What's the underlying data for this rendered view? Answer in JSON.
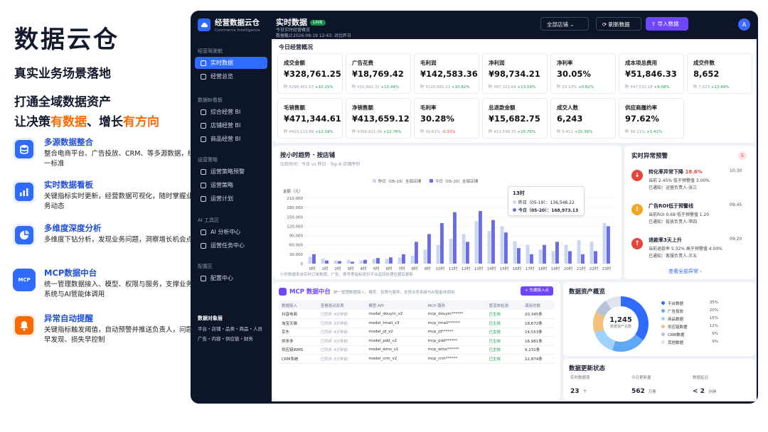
{
  "left": {
    "brand": "数据云仓",
    "tagline": "真实业务场景落地",
    "slogan1": "打通全域数据资产",
    "slogan2_a": "让决策",
    "slogan2_b": "有数据",
    "slogan2_c": "、增长",
    "slogan2_d": "有方向",
    "features": [
      {
        "icon": "database-icon",
        "color": "#2f6bff",
        "title": "多源数据整合",
        "desc": "整合电商平台、广告投放、CRM、等多源数据，统一标准"
      },
      {
        "icon": "bar-chart-icon",
        "color": "#2f6bff",
        "title": "实时数据看板",
        "desc": "关键指标实时更新，经营数据可视化，随时掌握业务动态"
      },
      {
        "icon": "pie-chart-icon",
        "color": "#2f6bff",
        "title": "多维度深度分析",
        "desc": "多维度下钻分析，发现业务问题，洞察增长机会点"
      },
      {
        "icon": "mcp-icon",
        "color": "#2f6bff",
        "title": "MCP数据中台",
        "desc": "统一管理数据接入、模型、权限与服务，支撑业务系统与AI管能体调用"
      },
      {
        "icon": "bell-icon",
        "color": "#ff6a00",
        "title": "异常自动提醒",
        "desc": "关键指标触发阈值，自动预警并推送负责人，问题早发现、损失早控制"
      }
    ]
  },
  "app": {
    "name": "经营数据云仓",
    "sub": "Commerce Intelligence",
    "sec1": "经营驾驶舱",
    "nav1": [
      "实时数据",
      "经营总览"
    ],
    "sec2": "数据BI看板",
    "nav2": [
      "综合经营 BI",
      "店铺经营 BI",
      "商品经营 BI"
    ],
    "sec3": "运营策略",
    "nav3": [
      "运营策略预警",
      "运营策略",
      "运营计划"
    ],
    "sec4": "AI 工具区",
    "nav4": [
      "AI 分析中心",
      "运营任务中心"
    ],
    "sec5": "配置区",
    "nav5": [
      "配置中心"
    ],
    "sec6": "数据对象层",
    "objs1": "平台・店铺・品类・商品・人员",
    "objs2": "广告・内容・供应链・财务",
    "title": "实时数据",
    "live": "LIVE",
    "sub1": "今日实时经营概览",
    "sub2": "数据截止2026-08-19 12:43: 对比昨日",
    "store_select": "全部店铺 ⌄",
    "refresh": "⟳ 刷新数据",
    "import": "⇧ 导入数据",
    "avatar": "A"
  },
  "overview": {
    "title": "今日经营概况",
    "kpis": [
      {
        "label": "成交金额",
        "value": "¥328,761.25",
        "prev": "¥298,451.67",
        "chg": "+10.15%",
        "dir": "up"
      },
      {
        "label": "广告花费",
        "value": "¥18,769.42",
        "prev": "¥16,842.31",
        "chg": "+11.44%",
        "dir": "up"
      },
      {
        "label": "毛利润",
        "value": "¥142,583.36",
        "prev": "¥128,665.22",
        "chg": "+10.82%",
        "dir": "up"
      },
      {
        "label": "净利润",
        "value": "¥98,734.21",
        "prev": "¥87,221.64",
        "chg": "+13.19%",
        "dir": "up"
      },
      {
        "label": "净利率",
        "value": "30.05%",
        "prev": "29.23%",
        "chg": "+0.82%",
        "dir": "up"
      },
      {
        "label": "成本项总费用",
        "value": "¥51,846.33",
        "prev": "¥47,532.18",
        "chg": "+9.08%",
        "dir": "up"
      },
      {
        "label": "成交件数",
        "value": "8,652",
        "prev": "7,623",
        "chg": "+13.49%",
        "dir": "up"
      },
      {
        "label": "毛销售额",
        "value": "¥471,344.61",
        "prev": "¥420,123.88",
        "chg": "+12.19%",
        "dir": "up"
      },
      {
        "label": "净销售额",
        "value": "¥413,659.12",
        "prev": "¥366,821.36",
        "chg": "+12.76%",
        "dir": "up"
      },
      {
        "label": "毛利率",
        "value": "30.28%",
        "prev": "30.61%",
        "chg": "-0.33%",
        "dir": "down"
      },
      {
        "label": "总退款金额",
        "value": "¥15,682.75",
        "prev": "¥13,548.33",
        "chg": "+15.76%",
        "dir": "up"
      },
      {
        "label": "成交人数",
        "value": "6,243",
        "prev": "5,412",
        "chg": "+15.36%",
        "dir": "up"
      },
      {
        "label": "供应商履约率",
        "value": "97.62%",
        "prev": "96.21%",
        "chg": "+1.41%",
        "dir": "up"
      }
    ]
  },
  "trend": {
    "title": "按小时趋势 · 按店铺",
    "subtitle": "比较时间：今日 vs 昨日 · Top 8 店铺序列",
    "note": "小时数据来自实时订单数据，广告、费号等指标按日平台返回处理估算后更新",
    "tooltip_title": "13时",
    "tooltip_y": "昨日（05-19）：136,548.22",
    "tooltip_t": "今日（05-20）：168,973.13"
  },
  "chart_data": {
    "type": "bar",
    "ylabel": "金额（元）",
    "ylim": [
      0,
      210000
    ],
    "yticks": [
      "210,000",
      "180,000",
      "150,000",
      "120,000",
      "90,000",
      "60,000",
      "30,000",
      "0"
    ],
    "categories": [
      "0时",
      "1时",
      "2时",
      "3时",
      "4时",
      "5时",
      "6时",
      "7时",
      "8时",
      "9时",
      "10时",
      "11时",
      "12时",
      "13时",
      "14时",
      "15时",
      "16时",
      "17时",
      "18时",
      "19时",
      "20时",
      "21时",
      "22时",
      "23时"
    ],
    "series": [
      {
        "name": "昨日（05-19）全部店铺",
        "color": "#c9d6f2",
        "values": [
          22000,
          16000,
          10000,
          12000,
          10000,
          15000,
          15000,
          20000,
          25000,
          45000,
          60000,
          80000,
          95000,
          136548,
          105000,
          120000,
          72000,
          60000,
          45000,
          40000,
          60000,
          75000,
          70000,
          130000
        ]
      },
      {
        "name": "今日（05-20）全部店铺",
        "color": "#6a6ce6",
        "values": [
          30000,
          10000,
          8000,
          6000,
          12000,
          18000,
          20000,
          30000,
          70000,
          95000,
          130000,
          165000,
          70000,
          168973,
          140000,
          100000,
          50000,
          30000,
          60000,
          70000,
          40000,
          30000,
          40000,
          120000
        ]
      }
    ]
  },
  "alerts": {
    "title": "实时异常预警",
    "count": "5",
    "items": [
      {
        "icon": "arrow-down-icon",
        "color": "#e5453b",
        "title": "转化率异常下降",
        "val": "18.6%",
        "time": "10:30",
        "line1": "当前 2.45% 低于预警值 3.00%",
        "line2": "已通知：运营负责人-张三"
      },
      {
        "icon": "warning-icon",
        "color": "#f5a524",
        "title": "广告ROI低于预警线",
        "val": "",
        "time": "09:45",
        "line1": "当前ROI 0.68 低于预警值 1.20",
        "line2": "已通知：投放负责人-李四"
      },
      {
        "icon": "arrow-up-icon",
        "color": "#e5453b",
        "title": "退款率3天上升",
        "val": "",
        "time": "09:20",
        "line1": "当前退款率 5.32% 高于预警值 4.00%",
        "line2": "已通知：客服负责人-王五"
      }
    ],
    "link": "查看全部异常 ›"
  },
  "mcp": {
    "title": "MCP 数据中台",
    "desc": "统一管理数据接入、模型、权限与服务，支撑业务系统与AI智能体调用",
    "add": "+ 先建接入点",
    "headers": [
      "数据接入",
      "查看驱动及表",
      "模型 API",
      "MCP 服务",
      "管道体检测",
      "调用总数"
    ],
    "rows": [
      [
        "抖音电商",
        "已同步 4分钟前",
        "model_douyin_v2",
        "mcp_douyin******",
        "已生效",
        "20,345条"
      ],
      [
        "淘宝天猫",
        "已同步 3分钟前",
        "model_tmall_v3",
        "mcp_tmall******",
        "已生效",
        "18,672条"
      ],
      [
        "京东",
        "已同步 4分钟前",
        "model_jd_v2",
        "mcp_jd******",
        "已生效",
        "14,553条"
      ],
      [
        "拼多多",
        "已同步 3分钟前",
        "model_pdd_v2",
        "mcp_pdd******",
        "已生效",
        "16,981条"
      ],
      [
        "供应链WMS",
        "已同步 4分钟前",
        "model_wms_v1",
        "mcp_wms******",
        "已生效",
        "9,231条"
      ],
      [
        "CRM系统",
        "已同步 3分钟前",
        "model_crm_v2",
        "mcp_crm******",
        "已生效",
        "12,874条"
      ]
    ]
  },
  "assets": {
    "title": "数据资产概览",
    "total": "1,245",
    "total_label": "数据资产总数",
    "legend": [
      {
        "name": "平台数据",
        "pct": "35%",
        "color": "#2f6bff"
      },
      {
        "name": "广告投放",
        "pct": "20%",
        "color": "#5fa8f5"
      },
      {
        "name": "商品数据",
        "pct": "15%",
        "color": "#9ed2ff"
      },
      {
        "name": "供应链数据",
        "pct": "12%",
        "color": "#f5c17a"
      },
      {
        "name": "CRM数据",
        "pct": "9%",
        "color": "#b9c3d6"
      },
      {
        "name": "其他数据",
        "pct": "9%",
        "color": "#dfe4ee"
      }
    ],
    "slices": [
      35,
      20,
      15,
      12,
      9,
      9
    ]
  },
  "status": {
    "title": "数据更新状态",
    "items": [
      {
        "label": "实时数据源",
        "value": "23",
        "unit": "个"
      },
      {
        "label": "今日更新量",
        "value": "562",
        "unit": "万条"
      },
      {
        "label": "数据延迟",
        "value": "< 2",
        "unit": "分钟"
      }
    ]
  }
}
